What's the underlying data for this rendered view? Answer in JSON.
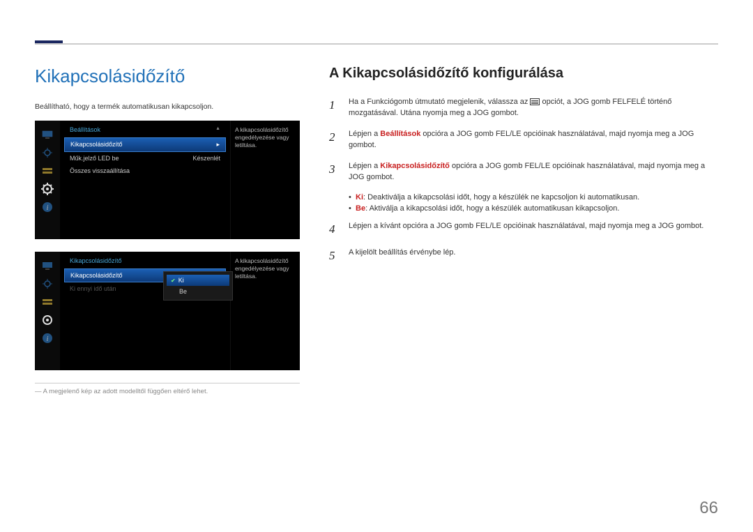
{
  "page_number": "66",
  "left": {
    "title": "Kikapcsolásidőzítő",
    "intro": "Beállítható, hogy a termék automatikusan kikapcsoljon.",
    "footnote": "― A megjelenő kép az adott modelltől függően eltérő lehet.",
    "osd1": {
      "header": "Beállítások",
      "items": [
        {
          "label": "Kikapcsolásidőzítő",
          "value": "",
          "selected": true,
          "arrow": true
        },
        {
          "label": "Műk.jelző LED be",
          "value": "Készenlét"
        },
        {
          "label": "Összes visszaállítása",
          "value": ""
        }
      ],
      "side": "A kikapcsolásidőzítő engedélyezése vagy letiltása."
    },
    "osd2": {
      "header": "Kikapcsolásidőzítő",
      "items": [
        {
          "label": "Kikapcsolásidőzítő",
          "value": "",
          "selected": true
        },
        {
          "label": "Ki ennyi idő után",
          "value": "",
          "dim": true
        }
      ],
      "popup": [
        {
          "label": "Ki",
          "selected": true,
          "check": true
        },
        {
          "label": "Be"
        }
      ],
      "side": "A kikapcsolásidőzítő engedélyezése vagy letiltása."
    }
  },
  "right": {
    "title": "A Kikapcsolásidőzítő konfigurálása",
    "steps": [
      {
        "n": "1",
        "pre": "Ha a Funkciógomb útmutató megjelenik, válassza az ",
        "icon": true,
        "post": " opciót, a JOG gomb FELFELÉ történő mozgatásával. Utána nyomja meg a JOG gombot."
      },
      {
        "n": "2",
        "pre": "Lépjen a ",
        "kw": "Beállítások",
        "post": " opcióra a JOG gomb FEL/LE opcióinak használatával, majd nyomja meg a JOG gombot."
      },
      {
        "n": "3",
        "pre": "Lépjen a ",
        "kw": "Kikapcsolásidőzítő",
        "post": " opcióra a JOG gomb FEL/LE opcióinak használatával, majd nyomja meg a JOG gombot."
      }
    ],
    "bullets": [
      {
        "kw": "Ki",
        "text": ": Deaktiválja a kikapcsolási időt, hogy a készülék ne kapcsoljon ki automatikusan."
      },
      {
        "kw": "Be",
        "text": ": Aktiválja a kikapcsolási időt, hogy a készülék automatikusan kikapcsoljon."
      }
    ],
    "steps2": [
      {
        "n": "4",
        "text": "Lépjen a kívánt opcióra a JOG gomb FEL/LE opcióinak használatával, majd nyomja meg a JOG gombot."
      },
      {
        "n": "5",
        "text": "A kijelölt beállítás érvénybe lép."
      }
    ]
  }
}
